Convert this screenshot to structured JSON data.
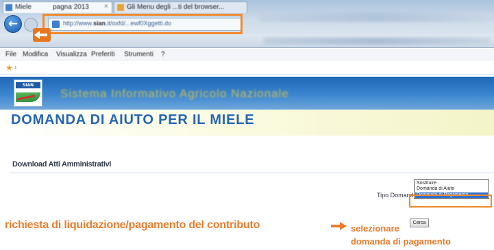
{
  "browser": {
    "address": {
      "prefix": "http://www.",
      "bold": "sian",
      "suffix": ".it/oxfd/...ewf0Xggetti.do"
    },
    "tabs": [
      {
        "label": "Miele",
        "after": "pagna 2013",
        "close": "×"
      },
      {
        "label": "Gli Menu degli ...ti del browser..."
      }
    ],
    "menu": [
      "File",
      "Modifica",
      "Visualizza",
      "Preferiti",
      "Strumenti",
      "?"
    ],
    "fav_arrow": "›"
  },
  "site": {
    "logo_text": "SIAN",
    "banner_text": "Sistema Informativo Agricolo Nazionale",
    "title": "DOMANDA DI AIUTO PER IL MIELE"
  },
  "form": {
    "section_title": "Download Atti Amministrativi",
    "tipo_domanda_label": "Tipo Domanda:",
    "select_options": [
      "Sostituire",
      "Domanda di Aiuto",
      "Domanda di Pagamento"
    ],
    "selected_index": 2,
    "search_button": "Cerca"
  },
  "annotations": {
    "main": "richiesta di liquidazione/pagamento del contributo",
    "select_line1": "selezionare",
    "select_line2": "domanda di pagamento",
    "color": "#ef7a2a"
  },
  "icons": {
    "back": "back-arrow-icon",
    "forward": "forward-arrow-icon",
    "favorites": "star-icon"
  }
}
